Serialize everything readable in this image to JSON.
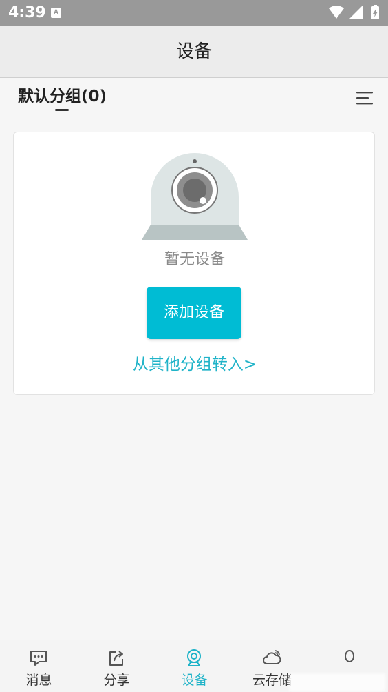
{
  "status_bar": {
    "time": "4:39",
    "notification_badge": "A",
    "icons": [
      "wifi-icon",
      "signal-icon",
      "battery-icon"
    ]
  },
  "header": {
    "title": "设备"
  },
  "group": {
    "label": "默认分组(0)",
    "menu_icon": "list-menu-icon"
  },
  "empty_state": {
    "illustration_icon": "camera-icon",
    "message": "暂无设备",
    "add_button_label": "添加设备",
    "transfer_link": "从其他分组转入>"
  },
  "bottom_nav": {
    "items": [
      {
        "label": "消息",
        "icon": "message-icon"
      },
      {
        "label": "分享",
        "icon": "share-icon"
      },
      {
        "label": "设备",
        "icon": "device-icon",
        "active": true
      },
      {
        "label": "云存储",
        "icon": "cloud-icon"
      },
      {
        "label": "",
        "icon": "profile-icon"
      }
    ]
  },
  "colors": {
    "accent": "#00bcd4",
    "link": "#1fb3c8",
    "status_bar": "#999999",
    "header_bg": "#ececec"
  }
}
